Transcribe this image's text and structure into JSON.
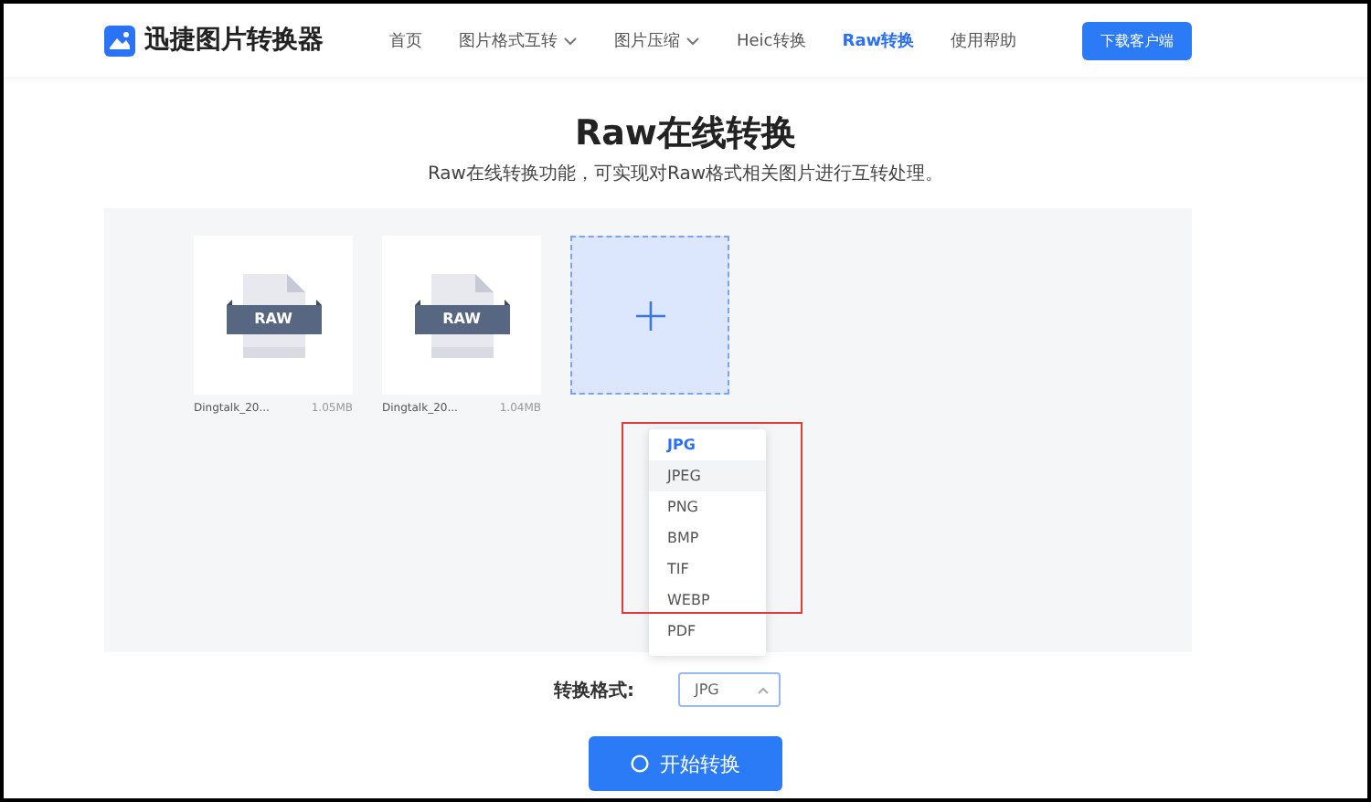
{
  "header": {
    "logo": "迅捷图片转换器",
    "nav": [
      {
        "label": "首页",
        "selected": false,
        "has_menu": false
      },
      {
        "label": "图片格式互转",
        "selected": false,
        "has_menu": true
      },
      {
        "label": "图片压缩",
        "selected": false,
        "has_menu": true
      },
      {
        "label": "Heic转换",
        "selected": false,
        "has_menu": false
      },
      {
        "label": "Raw转换",
        "selected": true,
        "has_menu": false
      },
      {
        "label": "使用帮助",
        "selected": false,
        "has_menu": false
      }
    ],
    "download_button": "下载客户端"
  },
  "title": "Raw在线转换",
  "subtitle": "Raw在线转换功能，可实现对Raw格式相关图片进行互转处理。",
  "files": [
    {
      "name": "Dingtalk_20...",
      "size": "1.05MB",
      "badge": "RAW"
    },
    {
      "name": "Dingtalk_20...",
      "size": "1.04MB",
      "badge": "RAW"
    }
  ],
  "format_field": {
    "label": "转换格式:",
    "value": "JPG",
    "expanded": true,
    "options": [
      {
        "label": "JPG",
        "selected": true,
        "hovered": false
      },
      {
        "label": "JPEG",
        "selected": false,
        "hovered": true
      },
      {
        "label": "PNG",
        "selected": false,
        "hovered": false
      },
      {
        "label": "BMP",
        "selected": false,
        "hovered": false
      },
      {
        "label": "TIF",
        "selected": false,
        "hovered": false
      },
      {
        "label": "WEBP",
        "selected": false,
        "hovered": false
      },
      {
        "label": "PDF",
        "selected": false,
        "hovered": false
      }
    ]
  },
  "start_button": "开始转换"
}
